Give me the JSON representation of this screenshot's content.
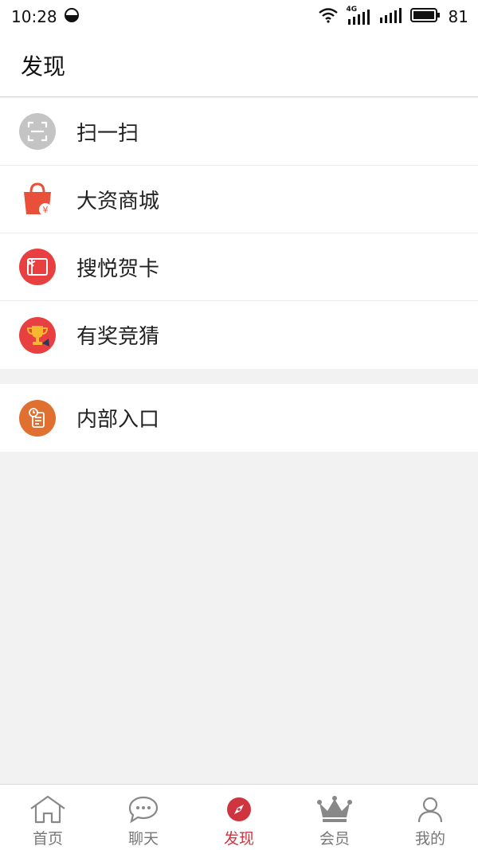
{
  "status_bar": {
    "time": "10:28",
    "network": "4G",
    "battery": "81"
  },
  "header": {
    "title": "发现"
  },
  "menu_group_1": [
    {
      "label": "扫一扫",
      "icon": "scan-icon",
      "color": "#c4c4c4"
    },
    {
      "label": "大资商城",
      "icon": "shopping-bag-icon",
      "color": "#e8503a"
    },
    {
      "label": "搜悦贺卡",
      "icon": "greeting-card-icon",
      "color": "#e84040"
    },
    {
      "label": "有奖竞猜",
      "icon": "trophy-icon",
      "color": "#e84040"
    }
  ],
  "menu_group_2": [
    {
      "label": "内部入口",
      "icon": "document-icon",
      "color": "#e07030"
    }
  ],
  "tabs": [
    {
      "label": "首页",
      "icon": "home-icon",
      "active": false
    },
    {
      "label": "聊天",
      "icon": "chat-icon",
      "active": false
    },
    {
      "label": "发现",
      "icon": "compass-icon",
      "active": true
    },
    {
      "label": "会员",
      "icon": "crown-icon",
      "active": false
    },
    {
      "label": "我的",
      "icon": "user-icon",
      "active": false
    }
  ],
  "colors": {
    "accent": "#d0353f",
    "background": "#f2f2f2"
  }
}
